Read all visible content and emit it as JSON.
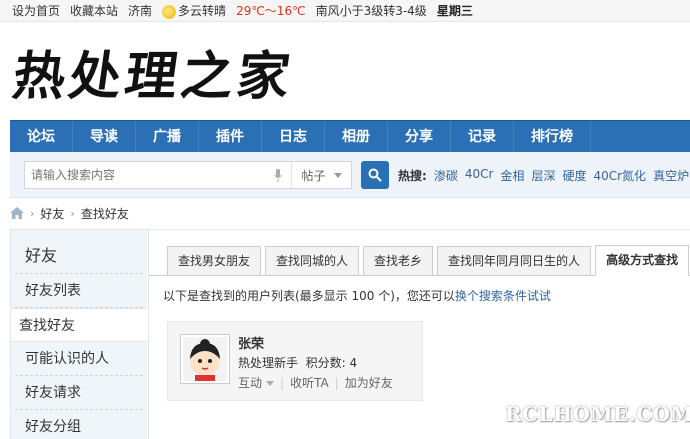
{
  "topbar": {
    "set_home": "设为首页",
    "bookmark": "收藏本站",
    "city": "济南",
    "weather": "多云转晴",
    "temp": "29℃～16℃",
    "wind": "南风小于3级转3-4级",
    "weekday": "星期三"
  },
  "logo": {
    "text": "热处理之家"
  },
  "nav": {
    "items": [
      "论坛",
      "导读",
      "广播",
      "插件",
      "日志",
      "相册",
      "分享",
      "记录",
      "排行榜"
    ]
  },
  "search": {
    "placeholder": "请输入搜索内容",
    "type_selected": "帖子",
    "hot_label": "热搜:",
    "hot_terms": [
      "渗碳",
      "40Cr",
      "金相",
      "层深",
      "硬度",
      "40Cr氮化",
      "真空炉"
    ]
  },
  "breadcrumb": {
    "items": [
      "好友",
      "查找好友"
    ]
  },
  "sidebar": {
    "title": "好友",
    "items": [
      {
        "label": "好友列表"
      },
      {
        "label": "查找好友"
      },
      {
        "label": "可能认识的人"
      },
      {
        "label": "好友请求"
      },
      {
        "label": "好友分组"
      }
    ],
    "active_index": 1
  },
  "tabs": {
    "items": [
      "查找男女朋友",
      "查找同城的人",
      "查找老乡",
      "查找同年同月同日生的人",
      "高级方式查找"
    ],
    "active_index": 4
  },
  "info": {
    "text": "以下是查找到的用户列表(最多显示 100 个)，您还可以",
    "link": "换个搜索条件试试"
  },
  "user": {
    "name": "张荣",
    "level": "热处理新手",
    "points_label": "积分数: 4",
    "action_interact": "互动",
    "action_follow": "收听TA",
    "action_add": "加为好友"
  },
  "watermark": {
    "text": "RCLHOME.COM"
  },
  "colors": {
    "nav_bg": "#2b6fb5",
    "link": "#336699",
    "temp": "#e0301e"
  }
}
